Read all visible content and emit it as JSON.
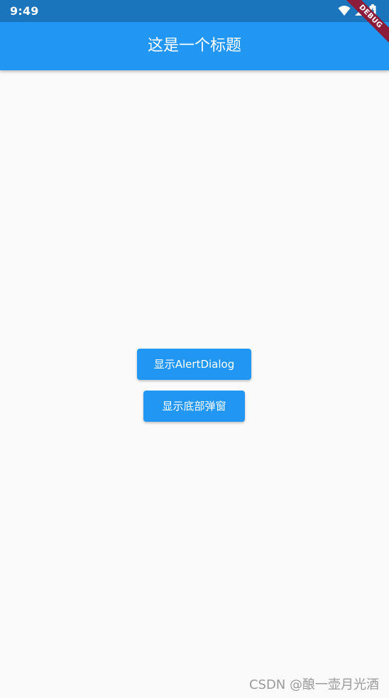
{
  "status_bar": {
    "time": "9:49",
    "icons": [
      "wifi-icon",
      "signal-icon",
      "battery-charging-icon"
    ]
  },
  "debug_banner": {
    "label": "DEBUG"
  },
  "app_bar": {
    "title": "这是一个标题",
    "color": "#2196f3"
  },
  "buttons": {
    "show_alert_dialog": "显示AlertDialog",
    "show_bottom_sheet": "显示底部弹窗"
  },
  "watermark": {
    "text": "CSDN @酿一壶月光酒"
  },
  "colors": {
    "primary": "#2196f3",
    "status_bar": "#1b75bc",
    "background": "#fafafa",
    "debug_ribbon": "#8b1c3a"
  }
}
